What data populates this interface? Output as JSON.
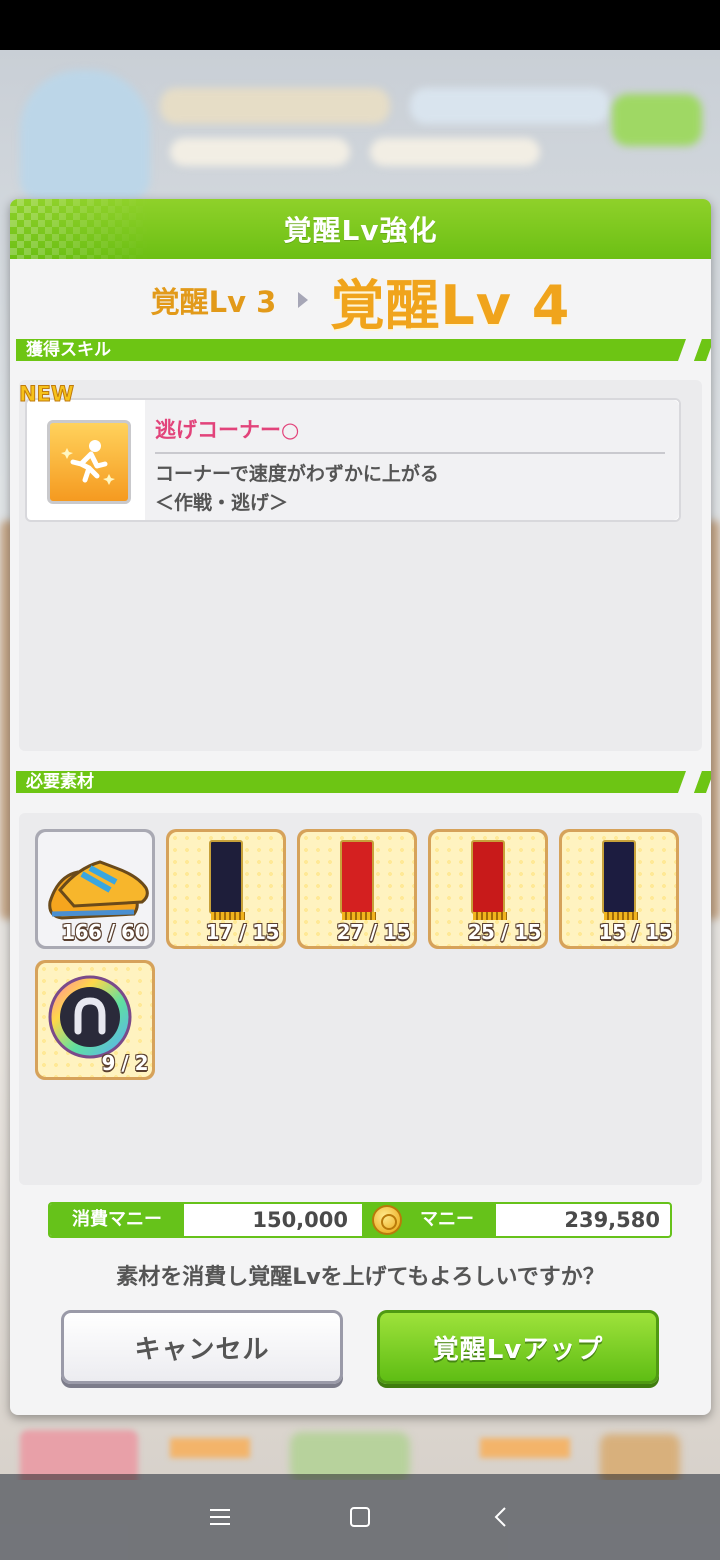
{
  "modal": {
    "title": "覚醒Lv強化",
    "level_from": "覚醒Lv 3",
    "level_to": "覚醒Lv 4"
  },
  "skill_section": {
    "label": "獲得スキル",
    "new_badge": "NEW",
    "skill_name": "逃げコーナー○",
    "skill_desc_line1": "コーナーで速度がわずかに上がる",
    "skill_desc_line2": "＜作戦・逃げ＞"
  },
  "materials_section": {
    "label": "必要素材",
    "items": [
      {
        "name": "shoes",
        "count": "166 / 60"
      },
      {
        "name": "banner-1",
        "count": "17 / 15"
      },
      {
        "name": "banner-satsuki",
        "count": "27 / 15"
      },
      {
        "name": "banner-derby",
        "count": "25 / 15"
      },
      {
        "name": "banner-kikka",
        "count": "15 / 15"
      },
      {
        "name": "horseshoe-crystal",
        "count": "9 / 2"
      }
    ]
  },
  "money": {
    "cost_label": "消費マニー",
    "cost_value": "150,000",
    "balance_label": "マニー",
    "balance_value": "239,580"
  },
  "confirm": {
    "question": "素材を消費し覚醒Lvを上げてもよろしいですか？",
    "cancel_label": "キャンセル",
    "ok_label": "覚醒Lvアップ"
  },
  "colors": {
    "accent_green": "#6dc514",
    "level_orange": "#f0a41c",
    "skill_pink": "#e2437a"
  }
}
